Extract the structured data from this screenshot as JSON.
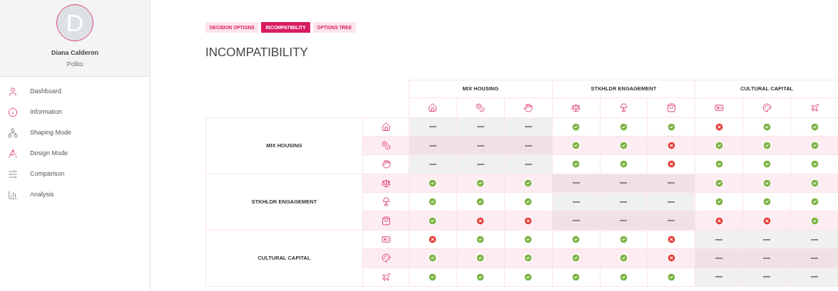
{
  "profile": {
    "initial": "D",
    "name": "Diana Calderon",
    "org": "Polito"
  },
  "nav": [
    {
      "label": "Dashboard",
      "kind": "user"
    },
    {
      "label": "Information",
      "kind": "info"
    },
    {
      "label": "Shaping Mode",
      "kind": "network"
    },
    {
      "label": "Design Mode",
      "kind": "compass"
    },
    {
      "label": "Comparison",
      "kind": "sliders"
    },
    {
      "label": "Analysis",
      "kind": "chart"
    }
  ],
  "tabs": [
    {
      "label": "DECISION OPTIONS",
      "selected": false
    },
    {
      "label": "INCOMPATIBILITY",
      "selected": true
    },
    {
      "label": "OPTIONS TREE",
      "selected": false
    }
  ],
  "title": "INCOMPATIBILITY",
  "column_groups": [
    {
      "name": "MIX HOUSING",
      "options": [
        {
          "kind": "house"
        },
        {
          "kind": "coin"
        },
        {
          "kind": "hand"
        }
      ]
    },
    {
      "name": "STKHLDR ENGAGEMENT",
      "options": [
        {
          "kind": "scale"
        },
        {
          "kind": "lamp"
        },
        {
          "kind": "bag"
        }
      ]
    },
    {
      "name": "CULTURAL CAPITAL",
      "options": [
        {
          "kind": "card"
        },
        {
          "kind": "palette"
        },
        {
          "kind": "plane"
        }
      ]
    }
  ],
  "row_groups": [
    {
      "name": "MIX HOUSING",
      "rows": [
        {
          "kind": "house",
          "cells": [
            {
              "kind": "dash"
            },
            {
              "kind": "dash"
            },
            {
              "kind": "dash"
            },
            {
              "kind": "check"
            },
            {
              "kind": "check"
            },
            {
              "kind": "check"
            },
            {
              "kind": "cross"
            },
            {
              "kind": "check"
            },
            {
              "kind": "check"
            }
          ]
        },
        {
          "kind": "coin",
          "cells": [
            {
              "kind": "dash"
            },
            {
              "kind": "dash"
            },
            {
              "kind": "dash"
            },
            {
              "kind": "check"
            },
            {
              "kind": "check"
            },
            {
              "kind": "cross"
            },
            {
              "kind": "check"
            },
            {
              "kind": "check"
            },
            {
              "kind": "check"
            }
          ]
        },
        {
          "kind": "hand",
          "cells": [
            {
              "kind": "dash"
            },
            {
              "kind": "dash"
            },
            {
              "kind": "dash"
            },
            {
              "kind": "check"
            },
            {
              "kind": "check"
            },
            {
              "kind": "cross"
            },
            {
              "kind": "check"
            },
            {
              "kind": "check"
            },
            {
              "kind": "check"
            }
          ]
        }
      ]
    },
    {
      "name": "STKHLDR ENGAGEMENT",
      "rows": [
        {
          "kind": "scale",
          "cells": [
            {
              "kind": "check"
            },
            {
              "kind": "check"
            },
            {
              "kind": "check"
            },
            {
              "kind": "dash"
            },
            {
              "kind": "dash"
            },
            {
              "kind": "dash"
            },
            {
              "kind": "check"
            },
            {
              "kind": "check"
            },
            {
              "kind": "check"
            }
          ]
        },
        {
          "kind": "lamp",
          "cells": [
            {
              "kind": "check"
            },
            {
              "kind": "check"
            },
            {
              "kind": "check"
            },
            {
              "kind": "dash"
            },
            {
              "kind": "dash"
            },
            {
              "kind": "dash"
            },
            {
              "kind": "check"
            },
            {
              "kind": "check"
            },
            {
              "kind": "check"
            }
          ]
        },
        {
          "kind": "bag",
          "cells": [
            {
              "kind": "check"
            },
            {
              "kind": "cross"
            },
            {
              "kind": "cross"
            },
            {
              "kind": "dash"
            },
            {
              "kind": "dash"
            },
            {
              "kind": "dash"
            },
            {
              "kind": "cross"
            },
            {
              "kind": "cross"
            },
            {
              "kind": "check"
            }
          ]
        }
      ]
    },
    {
      "name": "CULTURAL CAPITAL",
      "rows": [
        {
          "kind": "card",
          "cells": [
            {
              "kind": "cross"
            },
            {
              "kind": "check"
            },
            {
              "kind": "check"
            },
            {
              "kind": "check"
            },
            {
              "kind": "check"
            },
            {
              "kind": "cross"
            },
            {
              "kind": "dash"
            },
            {
              "kind": "dash"
            },
            {
              "kind": "dash"
            }
          ]
        },
        {
          "kind": "palette",
          "cells": [
            {
              "kind": "check"
            },
            {
              "kind": "check"
            },
            {
              "kind": "check"
            },
            {
              "kind": "check"
            },
            {
              "kind": "check"
            },
            {
              "kind": "cross"
            },
            {
              "kind": "dash"
            },
            {
              "kind": "dash"
            },
            {
              "kind": "dash"
            }
          ]
        },
        {
          "kind": "plane",
          "cells": [
            {
              "kind": "check"
            },
            {
              "kind": "check"
            },
            {
              "kind": "check"
            },
            {
              "kind": "check"
            },
            {
              "kind": "check"
            },
            {
              "kind": "check"
            },
            {
              "kind": "dash"
            },
            {
              "kind": "dash"
            },
            {
              "kind": "dash"
            }
          ]
        }
      ]
    }
  ]
}
